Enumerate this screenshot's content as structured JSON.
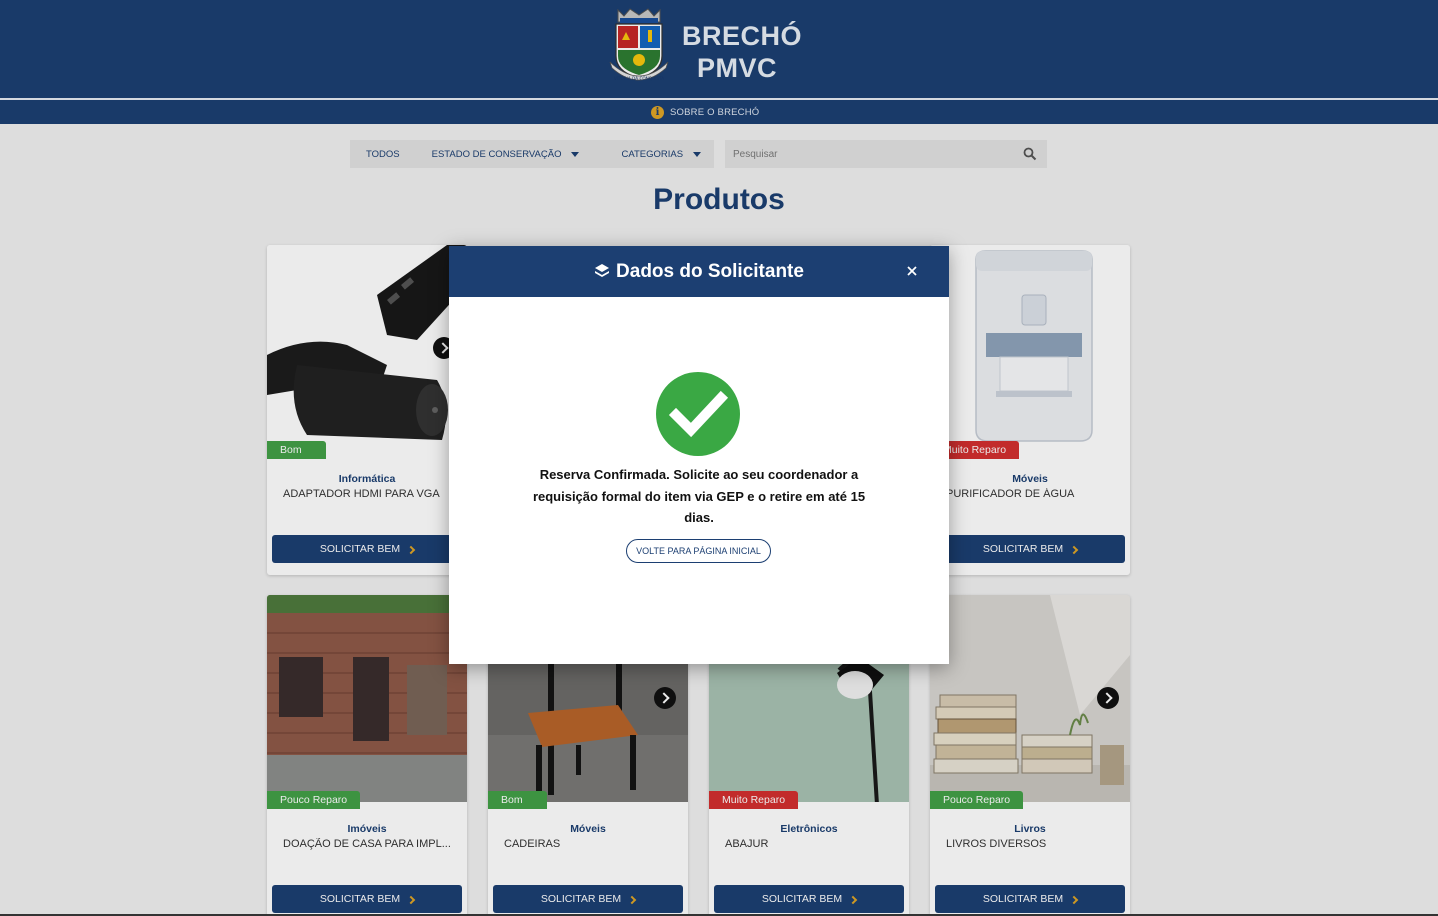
{
  "header": {
    "brand_line1": "BRECHÓ",
    "brand_line2": "PMVC",
    "crest_text": "VITÓRIA DA CONQUISTA",
    "about_label": "SOBRE O BRECHÓ"
  },
  "filters": {
    "all_label": "TODOS",
    "condition_label": "ESTADO DE CONSERVAÇÃO",
    "categories_label": "CATEGORIAS",
    "search_placeholder": "Pesquisar"
  },
  "page_title": "Produtos",
  "products": [
    {
      "condition": "Bom",
      "category": "Informática",
      "name": "ADAPTADOR HDMI PARA VGA",
      "button": "SOLICITAR BEM"
    },
    {
      "condition": "Muito Reparo",
      "category": "Móveis",
      "name": "PURIFICADOR DE ÁGUA",
      "button": "SOLICITAR BEM"
    },
    {
      "condition": "Pouco Reparo",
      "category": "Imóveis",
      "name": "DOAÇÃO DE CASA PARA IMPL...",
      "button": "SOLICITAR BEM"
    },
    {
      "condition": "Bom",
      "category": "Móveis",
      "name": "CADEIRAS",
      "button": "SOLICITAR BEM"
    },
    {
      "condition": "Muito Reparo",
      "category": "Eletrônicos",
      "name": "ABAJUR",
      "button": "SOLICITAR BEM"
    },
    {
      "condition": "Pouco Reparo",
      "category": "Livros",
      "name": "LIVROS DIVERSOS",
      "button": "SOLICITAR BEM"
    }
  ],
  "modal": {
    "title": "Dados do Solicitante",
    "message": "Reserva Confirmada. Solicite ao seu coordenador a requisição formal do item via GEP e o retire em até 15 dias.",
    "back_button": "VOLTE PARA PÁGINA INICIAL"
  },
  "colors": {
    "primary": "#1c3f72",
    "accent": "#e0a526",
    "good": "#43a047",
    "bad": "#d32f2f",
    "success": "#3aa844"
  }
}
